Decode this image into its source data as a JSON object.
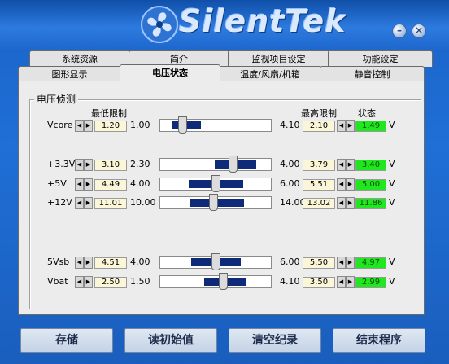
{
  "app": {
    "title": "SilentTek"
  },
  "tabs_row1": [
    "系统资源",
    "简介",
    "监视项目设定",
    "功能设定"
  ],
  "tabs_row2": [
    "图形显示",
    "电压状态",
    "温度/风扇/机箱",
    "静音控制"
  ],
  "active_tab": "电压状态",
  "group_title": "电压侦测",
  "headers": {
    "min": "最低限制",
    "max": "最高限制",
    "status": "状态"
  },
  "unit": "V",
  "rows": [
    {
      "label": "Vcore",
      "min_set": "1.20",
      "min_range": "1.00",
      "max_range": "4.10",
      "max_set": "2.10",
      "status": "1.49",
      "bar_fraction": [
        0.11,
        0.37
      ],
      "thumb_fraction": 0.19
    },
    {
      "label": "+3.3V",
      "min_set": "3.10",
      "min_range": "2.30",
      "max_range": "4.00",
      "max_set": "3.79",
      "status": "3.40",
      "bar_fraction": [
        0.49,
        0.87
      ],
      "thumb_fraction": 0.65
    },
    {
      "label": "+5V",
      "min_set": "4.49",
      "min_range": "4.00",
      "max_range": "6.00",
      "max_set": "5.51",
      "status": "5.00",
      "bar_fraction": [
        0.26,
        0.75
      ],
      "thumb_fraction": 0.49
    },
    {
      "label": "+12V",
      "min_set": "11.01",
      "min_range": "10.00",
      "max_range": "14.00",
      "max_set": "13.02",
      "status": "11.86",
      "bar_fraction": [
        0.27,
        0.76
      ],
      "thumb_fraction": 0.47
    },
    {
      "label": "5Vsb",
      "min_set": "4.51",
      "min_range": "4.00",
      "max_range": "6.00",
      "max_set": "5.50",
      "status": "4.97",
      "bar_fraction": [
        0.28,
        0.73
      ],
      "thumb_fraction": 0.49
    },
    {
      "label": "Vbat",
      "min_set": "2.50",
      "min_range": "1.50",
      "max_range": "4.10",
      "max_set": "3.50",
      "status": "2.99",
      "bar_fraction": [
        0.4,
        0.78
      ],
      "thumb_fraction": 0.56
    }
  ],
  "buttons": {
    "save": "存储",
    "read_defaults": "读初始值",
    "clear_log": "清空纪录",
    "exit": "结束程序"
  },
  "colors": {
    "bar": "#0f2a78",
    "status_bg": "#1fe81f",
    "value_bg": "#fbf6d8"
  }
}
